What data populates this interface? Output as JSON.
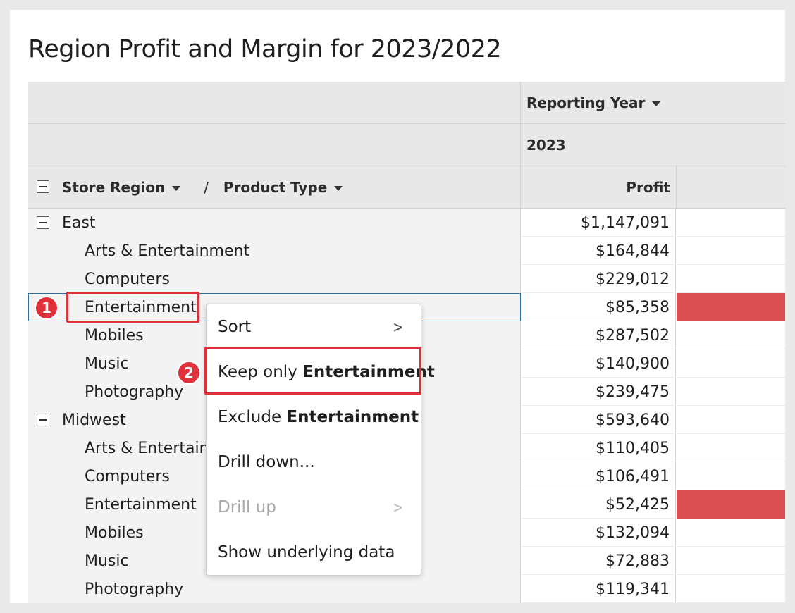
{
  "title": "Region Profit and Margin for 2023/2022",
  "column_header": {
    "label": "Reporting Year",
    "year": "2023",
    "measure": "Profit"
  },
  "row_header": {
    "region_label": "Store Region",
    "separator": "/",
    "product_label": "Product Type"
  },
  "rows": [
    {
      "label": "East",
      "value": "$1,147,091",
      "level": "group"
    },
    {
      "label": "Arts & Entertainment",
      "value": "$164,844",
      "level": "child"
    },
    {
      "label": "Computers",
      "value": "$229,012",
      "level": "child"
    },
    {
      "label": "Entertainment",
      "value": "$85,358",
      "level": "child",
      "highlight": true,
      "selected": true
    },
    {
      "label": "Mobiles",
      "value": "$287,502",
      "level": "child"
    },
    {
      "label": "Music",
      "value": "$140,900",
      "level": "child"
    },
    {
      "label": "Photography",
      "value": "$239,475",
      "level": "child"
    },
    {
      "label": "Midwest",
      "value": "$593,640",
      "level": "group"
    },
    {
      "label": "Arts & Entertainment",
      "value": "$110,405",
      "level": "child"
    },
    {
      "label": "Computers",
      "value": "$106,491",
      "level": "child"
    },
    {
      "label": "Entertainment",
      "value": "$52,425",
      "level": "child",
      "highlight": true
    },
    {
      "label": "Mobiles",
      "value": "$132,094",
      "level": "child"
    },
    {
      "label": "Music",
      "value": "$72,883",
      "level": "child"
    },
    {
      "label": "Photography",
      "value": "$119,341",
      "level": "child"
    }
  ],
  "context_menu": {
    "sort": "Sort",
    "keep_prefix": "Keep only ",
    "keep_value": "Entertainment",
    "exclude_prefix": "Exclude ",
    "exclude_value": "Entertainment",
    "drill_down": "Drill down...",
    "drill_up": "Drill up",
    "show_data": "Show underlying data",
    "chevron": ">"
  },
  "annotations": {
    "step1": "1",
    "step2": "2"
  },
  "colors": {
    "highlight_bar": "#d94f52",
    "annotation": "#e0303a",
    "selection": "#2e6fa0"
  }
}
